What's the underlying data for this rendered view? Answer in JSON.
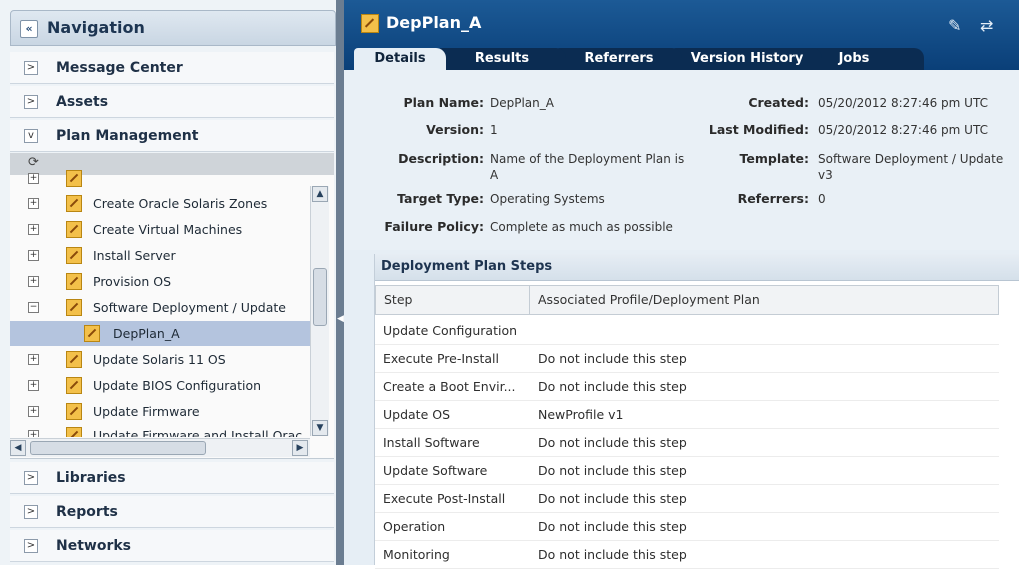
{
  "nav": {
    "title": "Navigation",
    "collapse_icon": "«",
    "accordions_top": [
      {
        "label": "Message Center",
        "expanded": false
      },
      {
        "label": "Assets",
        "expanded": false
      },
      {
        "label": "Plan Management",
        "expanded": true
      }
    ],
    "tree": [
      {
        "label": "Create Oracle Solaris Zones",
        "expander": "+"
      },
      {
        "label": "Create Virtual Machines",
        "expander": "+"
      },
      {
        "label": "Install Server",
        "expander": "+"
      },
      {
        "label": "Provision OS",
        "expander": "+"
      },
      {
        "label": "Software Deployment / Update",
        "expander": "−"
      },
      {
        "label": "DepPlan_A",
        "child": true,
        "selected": true
      },
      {
        "label": "Update Solaris 11 OS",
        "expander": "+"
      },
      {
        "label": "Update BIOS Configuration",
        "expander": "+"
      },
      {
        "label": "Update Firmware",
        "expander": "+"
      },
      {
        "label": "Update Firmware and Install Orac",
        "expander": "+"
      }
    ],
    "accordions_bottom": [
      {
        "label": "Libraries"
      },
      {
        "label": "Reports"
      },
      {
        "label": "Networks"
      }
    ]
  },
  "main": {
    "title": "DepPlan_A",
    "tabs": [
      "Details",
      "Results",
      "Referrers",
      "Version History",
      "Jobs"
    ],
    "active_tab": "Details",
    "details": {
      "plan_name_label": "Plan Name:",
      "plan_name": "DepPlan_A",
      "version_label": "Version:",
      "version": "1",
      "description_label": "Description:",
      "description_line1": "Name of the Deployment Plan is",
      "description_line2": "A",
      "target_type_label": "Target Type:",
      "target_type": "Operating Systems",
      "failure_policy_label": "Failure Policy:",
      "failure_policy": "Complete as much as possible",
      "created_label": "Created:",
      "created": "05/20/2012 8:27:46 pm UTC",
      "last_modified_label": "Last Modified:",
      "last_modified": "05/20/2012 8:27:46 pm UTC",
      "template_label": "Template:",
      "template_line1": "Software Deployment / Update",
      "template_line2": "v3",
      "referrers_label": "Referrers:",
      "referrers": "0"
    },
    "steps": {
      "title": "Deployment Plan Steps",
      "columns": [
        "Step",
        "Associated Profile/Deployment Plan"
      ],
      "rows": [
        {
          "step": "Update Configuration",
          "profile": ""
        },
        {
          "step": "Execute Pre-Install",
          "profile": "Do not include this step"
        },
        {
          "step": "Create a Boot Envir...",
          "profile": "Do not include this step"
        },
        {
          "step": "Update OS",
          "profile": "NewProfile v1"
        },
        {
          "step": "Install Software",
          "profile": "Do not include this step"
        },
        {
          "step": "Update Software",
          "profile": "Do not include this step"
        },
        {
          "step": "Execute Post-Install",
          "profile": "Do not include this step"
        },
        {
          "step": "Operation",
          "profile": "Do not include this step"
        },
        {
          "step": "Monitoring",
          "profile": "Do not include this step"
        }
      ]
    }
  }
}
